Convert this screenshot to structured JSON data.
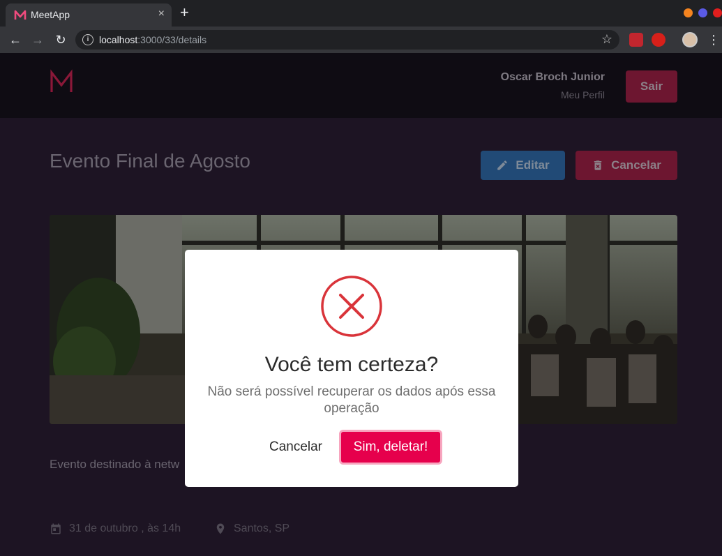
{
  "browser": {
    "tab_title": "MeetApp",
    "tab_close": "×",
    "new_tab": "+",
    "url_host": "localhost",
    "url_path": ":3000/33/details",
    "window_colors": [
      "#f5841f",
      "#5a5ae6",
      "#e01e1e"
    ]
  },
  "header": {
    "user_name": "Oscar Broch Junior",
    "profile_link": "Meu Perfil",
    "logout_label": "Sair"
  },
  "event": {
    "title": "Evento Final de Agosto",
    "edit_label": "Editar",
    "cancel_label": "Cancelar",
    "description": "Evento destinado à netw",
    "date": "31 de outubro , às 14h",
    "location": "Santos, SP"
  },
  "modal": {
    "title": "Você tem certeza?",
    "text": "Não será possível recuperar os dados após essa operação",
    "cancel_label": "Cancelar",
    "confirm_label": "Sim, deletar!",
    "icon": "error-x-icon"
  },
  "colors": {
    "accent": "#e6004c",
    "page_bg": "#1d1423",
    "header_bg": "#0f0c13",
    "edit_button": "#214a76",
    "danger_button": "#6d1630",
    "modal_icon": "#d9343a"
  }
}
